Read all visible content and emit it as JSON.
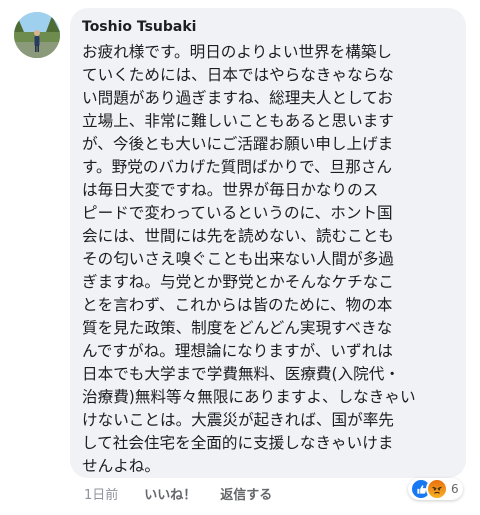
{
  "comment": {
    "author": "Toshio Tsubaki",
    "text": "お疲れ様です。明日のよりよい世界を構築し\nていくためには、日本ではやらなきゃならな\nい問題があり過ぎますね、総理夫人としてお\n立場上、非常に難しいこともあると思います\nが、今後とも大いにご活躍お願い申し上げま\nす。野党のバカげた質問ばかりで、旦那さん\nは毎日大変ですね。世界が毎日かなりのス\nピードで変わっているというのに、ホント国\n会には、世間には先を読めない、読むことも\nその匂いさえ嗅ぐことも出来ない人間が多過\nぎますね。与党とか野党とかそんなケチなこ\nとを言わず、これからは皆のために、物の本\n質を見た政策、制度をどんどん実現すべきな\nんですがね。理想論になりますが、いずれは\n日本でも大学まで学費無料、医療費(入院代・\n治療費)無料等々無限にありますよ、しなきゃい\nけないことは。大震災が起きれば、国が率先\nして社会住宅を全面的に支援しなきゃいけま\nせんよね。",
    "timestamp": "1日前",
    "like_label": "いいね！",
    "reply_label": "返信する",
    "reactions": {
      "count": "6",
      "types": [
        "like-icon",
        "angry-icon"
      ],
      "like_color": "#1877f2",
      "angry_color": "#f28a1b"
    }
  },
  "colors": {
    "bubble_background": "#f0f2f5",
    "text": "#1c1e21",
    "secondary_text": "#65676b"
  }
}
